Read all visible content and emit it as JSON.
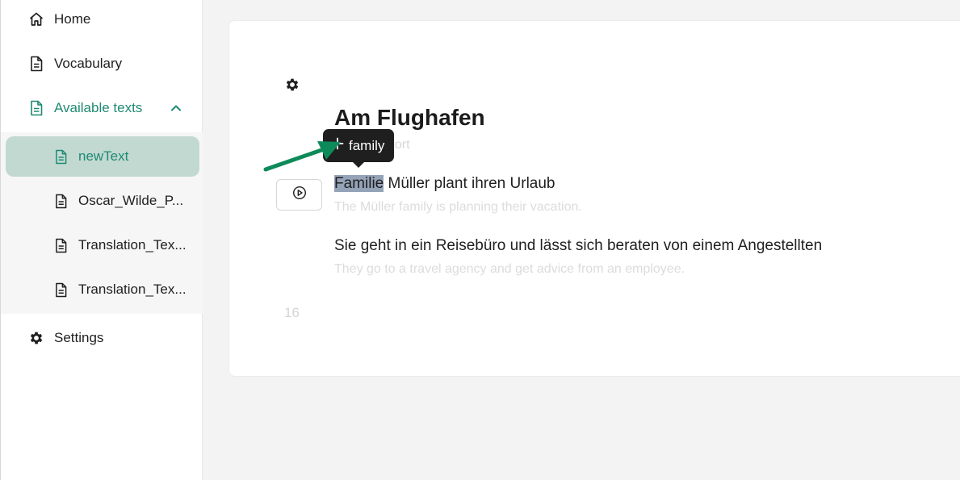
{
  "sidebar": {
    "items": [
      {
        "label": "Home",
        "icon": "home-icon"
      },
      {
        "label": "Vocabulary",
        "icon": "document-icon"
      },
      {
        "label": "Available texts",
        "icon": "document-icon",
        "expanded": true
      },
      {
        "label": "Settings",
        "icon": "gear-icon"
      }
    ],
    "texts": [
      {
        "label": "newText",
        "selected": true
      },
      {
        "label": "Oscar_Wilde_P..."
      },
      {
        "label": "Translation_Tex..."
      },
      {
        "label": "Translation_Tex..."
      }
    ]
  },
  "text_view": {
    "title": "Am Flughafen",
    "subtitle": "port",
    "sentences": [
      {
        "highlighted_word": "Familie",
        "rest": " Müller plant ihren Urlaub",
        "translation": "The Müller family is planning their vacation."
      },
      {
        "text": "Sie geht in ein Reisebüro und lässt sich beraten von einem Angestellten",
        "translation": "They go to a travel agency and get advice from an employee."
      }
    ],
    "page_number": "16"
  },
  "tooltip": {
    "label": "family",
    "icon": "plus-icon"
  },
  "colors": {
    "accent": "#1e8a72",
    "selected_bg": "#c2d9d1",
    "highlight": "#94a3b8",
    "tooltip_bg": "#1f1f1f",
    "arrow": "#0e8a5a"
  }
}
